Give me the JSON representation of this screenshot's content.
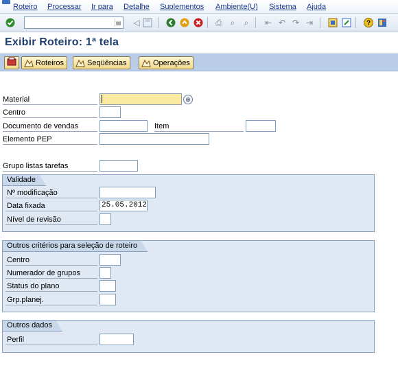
{
  "menu": [
    "Roteiro",
    "Processar",
    "Ir para",
    "Detalhe",
    "Suplementos",
    "Ambiente(U)",
    "Sistema",
    "Ajuda"
  ],
  "toolbar": {
    "command_field": "",
    "icons": [
      "enter-icon",
      "dropdown-icon",
      "back-save-icon",
      "save-icon",
      "back-icon",
      "exit-icon",
      "cancel-icon",
      "print-icon",
      "find-icon",
      "find-next-icon",
      "first-page-icon",
      "prev-page-icon",
      "next-page-icon",
      "last-page-icon",
      "new-session-icon",
      "shortcut-icon",
      "help-icon",
      "layout-icon"
    ]
  },
  "title": "Exibir Roteiro: 1ª tela",
  "app_toolbar": {
    "buttons": [
      "Roteiros",
      "Seqüências",
      "Operações"
    ]
  },
  "form": {
    "material_label": "Material",
    "material_value": "",
    "centro_label": "Centro",
    "centro_value": "",
    "doc_vendas_label": "Documento de vendas",
    "doc_vendas_value": "",
    "item_label": "Item",
    "item_value": "",
    "pep_label": "Elemento PEP",
    "pep_value": "",
    "grupo_label": "Grupo listas tarefas",
    "grupo_value": ""
  },
  "validade": {
    "title": "Validade",
    "modificacao_label": "Nº modificação",
    "modificacao_value": "",
    "data_label": "Data fixada",
    "data_value": "25.05.2012",
    "revisao_label": "Nível de revisão",
    "revisao_value": ""
  },
  "outros_criterios": {
    "title": "Outros critérios para seleção de roteiro",
    "centro_label": "Centro",
    "centro_value": "",
    "numerador_label": "Numerador de grupos",
    "numerador_value": "",
    "status_label": "Status do plano",
    "status_value": "",
    "grp_label": "Grp.planej.",
    "grp_value": ""
  },
  "outros_dados": {
    "title": "Outros dados",
    "perfil_label": "Perfil",
    "perfil_value": ""
  },
  "colors": {
    "title": "#1f3f6e",
    "app_toolbar": "#b9cde8",
    "required_field": "#fbeba0",
    "group_bg": "#dfe8f3"
  }
}
